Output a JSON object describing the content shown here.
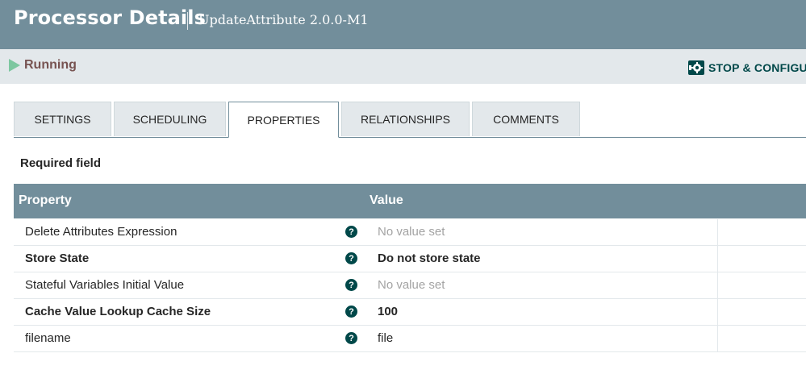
{
  "header": {
    "title": "Processor Details",
    "subtitle": "UpdateAttribute 2.0.0-M1"
  },
  "status": {
    "icon": "play-icon",
    "label": "Running",
    "color": "#7dc7a0"
  },
  "actions": {
    "stop_configure_icon": "gear-stop-icon",
    "stop_configure_label": "STOP & CONFIGU"
  },
  "tabs": [
    {
      "label": "SETTINGS",
      "active": false
    },
    {
      "label": "SCHEDULING",
      "active": false
    },
    {
      "label": "PROPERTIES",
      "active": true
    },
    {
      "label": "RELATIONSHIPS",
      "active": false
    },
    {
      "label": "COMMENTS",
      "active": false
    }
  ],
  "required_label": "Required field",
  "table": {
    "headers": {
      "property": "Property",
      "value": "Value"
    },
    "rows": [
      {
        "name": "Delete Attributes Expression",
        "value": "No value set",
        "required": false,
        "empty": true
      },
      {
        "name": "Store State",
        "value": "Do not store state",
        "required": true,
        "empty": false
      },
      {
        "name": "Stateful Variables Initial Value",
        "value": "No value set",
        "required": false,
        "empty": true
      },
      {
        "name": "Cache Value Lookup Cache Size",
        "value": "100",
        "required": true,
        "empty": false
      },
      {
        "name": "filename",
        "value": "file",
        "required": false,
        "empty": false
      }
    ],
    "help_icon": "question-circle-icon"
  },
  "colors": {
    "header_bg": "#728e9b",
    "status_bar_bg": "#e3e8eb",
    "accent": "#004849"
  }
}
